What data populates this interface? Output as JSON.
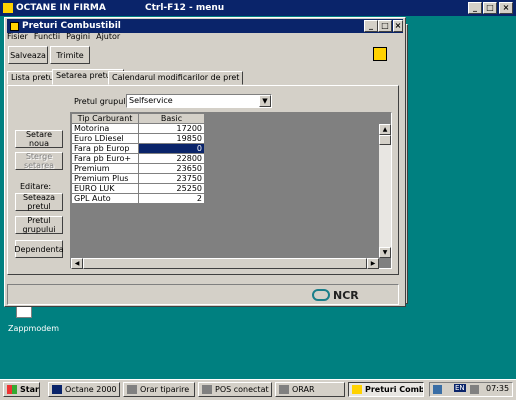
{
  "outer_window": {
    "title": "OCTANE IN FIRMA",
    "shortcut": "Ctrl-F12 - menu"
  },
  "app_window": {
    "title": "Preturi Combustibil",
    "menu": [
      "Fisier",
      "Functii",
      "Pagini",
      "Ajutor"
    ],
    "toolbar": {
      "save_label": "Salveaza",
      "send_label": "Trimite"
    },
    "tabs": [
      "Lista preturi",
      "Setarea pretului",
      "Calendarul modificarilor de pret"
    ],
    "active_tab": 1,
    "group_price": {
      "label": "Pretul grupului",
      "value": "Selfservice"
    },
    "side_buttons": {
      "new_setting": "Setare noua",
      "delete_setting": "Sterge setarea",
      "edit_label": "Editare:",
      "set_price": "Seteaza pretul",
      "group_price": "Pretul grupului",
      "dependency": "Dependenta"
    },
    "table": {
      "columns": [
        "Tip Carburant",
        "Basic"
      ],
      "rows": [
        {
          "name": "Motorina",
          "value": "17200"
        },
        {
          "name": "Euro LDiesel",
          "value": "19850"
        },
        {
          "name": "Fara pb Europ",
          "value": "0"
        },
        {
          "name": "Fara pb Euro+",
          "value": "22800"
        },
        {
          "name": "Premium",
          "value": "23650"
        },
        {
          "name": "Premium Plus",
          "value": "23750"
        },
        {
          "name": "EURO LUK",
          "value": "25250"
        },
        {
          "name": "GPL Auto",
          "value": "2"
        }
      ]
    },
    "footer_logo": "NCR"
  },
  "desktop": {
    "icon_label": "Zappmodem"
  },
  "taskbar": {
    "start": "Start",
    "items": [
      "Octane 2000 Fo...",
      "Orar tiparire",
      "POS conectat",
      "ORAR",
      "Preturi Combu..."
    ],
    "tray_lang": "EN",
    "clock": "07:35"
  }
}
